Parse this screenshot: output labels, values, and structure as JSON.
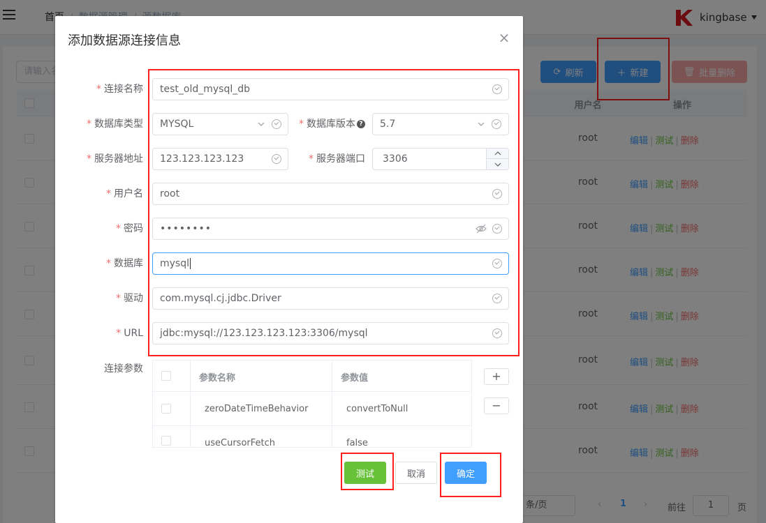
{
  "header": {
    "breadcrumb": [
      "首页",
      "数据源管理",
      "源数据库"
    ],
    "user_name": "kingbase",
    "brand_color": "#d71920"
  },
  "background": {
    "search_placeholder": "请输入名称",
    "refresh_label": "刷新",
    "create_label": "新建",
    "bulk_delete_label": "批量删除",
    "columns": {
      "user": "用户名",
      "actions": "操作"
    },
    "actions": {
      "edit": "编辑",
      "test": "测试",
      "delete": "删除"
    },
    "rows": [
      {
        "user": "root"
      },
      {
        "user": "root"
      },
      {
        "user": "root"
      },
      {
        "user": "root"
      },
      {
        "user": "root"
      },
      {
        "user": "root"
      },
      {
        "user": "root"
      },
      {
        "user": "root"
      }
    ],
    "pager": {
      "page_size": "条/页",
      "current_page": "1",
      "goto_label": "前往",
      "goto_value": "1",
      "page_unit": "页"
    }
  },
  "dialog": {
    "title": "添加数据源连接信息",
    "fields": {
      "conn_name": {
        "label": "连接名称",
        "value": "test_old_mysql_db"
      },
      "db_type": {
        "label": "数据库类型",
        "value": "MYSQL"
      },
      "db_version": {
        "label": "数据库版本",
        "value": "5.7"
      },
      "host": {
        "label": "服务器地址",
        "value": "123.123.123.123"
      },
      "port": {
        "label": "服务器端口",
        "value": "3306"
      },
      "username": {
        "label": "用户名",
        "value": "root"
      },
      "password": {
        "label": "密码",
        "value": "••••••••"
      },
      "database": {
        "label": "数据库",
        "value": "mysql"
      },
      "driver": {
        "label": "驱动",
        "value": "com.mysql.cj.jdbc.Driver"
      },
      "url": {
        "label": "URL",
        "value": "jdbc:mysql://123.123.123.123:3306/mysql"
      }
    },
    "params": {
      "label": "连接参数",
      "columns": {
        "name": "参数名称",
        "value": "参数值"
      },
      "rows": [
        {
          "name": "zeroDateTimeBehavior",
          "value": "convertToNull"
        },
        {
          "name": "useCursorFetch",
          "value": "false"
        }
      ],
      "add_symbol": "+",
      "remove_symbol": "−"
    },
    "buttons": {
      "test": "测试",
      "cancel": "取消",
      "confirm": "确定"
    }
  },
  "colors": {
    "primary": "#409eff",
    "success": "#67c23a",
    "danger": "#f56c6c",
    "annotation_red": "#ff1f1f"
  }
}
